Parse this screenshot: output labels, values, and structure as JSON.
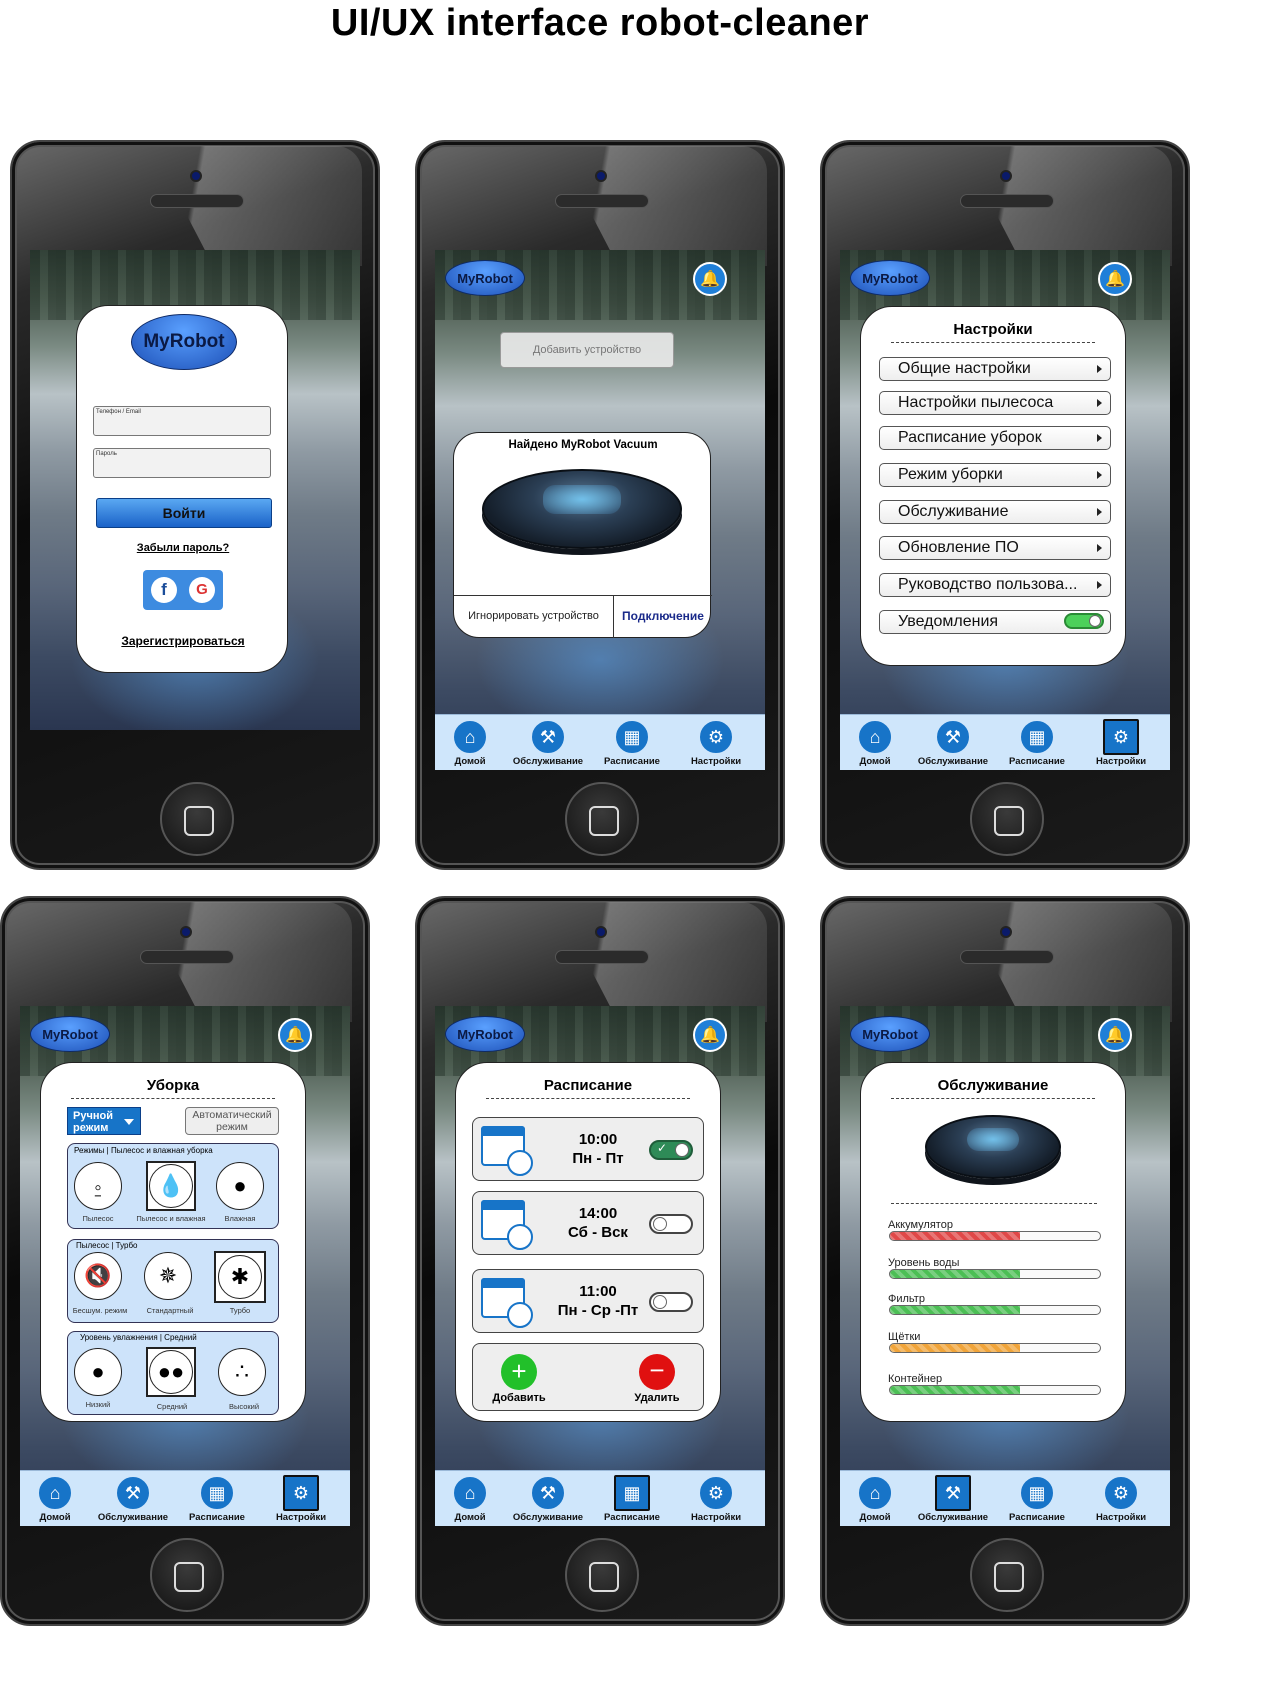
{
  "page_title": "UI/UX  interface robot-cleaner",
  "brand": "MyRobot",
  "nav": {
    "home": "Домой",
    "service": "Обслуживание",
    "schedule": "Расписание",
    "settings": "Настройки"
  },
  "login": {
    "brand": "MyRobot",
    "phone_label": "Телефон / Email",
    "password_label": "Пароль",
    "login_button": "Войти",
    "forgot": "Забыли пароль?",
    "register": "Зарегистрироваться",
    "facebook_letter": "f",
    "google_letter": "G"
  },
  "device": {
    "add_device_placeholder": "Добавить устройство",
    "found_title": "Найдено MyRobot Vacuum",
    "ignore": "Игнорировать устройство",
    "connect": "Подключение"
  },
  "settings": {
    "title": "Настройки",
    "items": [
      "Общие настройки",
      "Настройки пылесоса",
      "Расписание уборок",
      "Режим уборки",
      "Обслуживание",
      "Обновление ПО",
      "Руководство пользова..."
    ],
    "notifications": "Уведомления",
    "notifications_on": true
  },
  "cleaning": {
    "title": "Уборка",
    "manual_mode": "Ручной режим",
    "auto_mode": "Автоматический режим",
    "group1_title": "Режимы | Пылесос и влажная уборка",
    "group1_items": [
      "Пылесос",
      "Пылесос и влажная",
      "Влажная"
    ],
    "group2_title": "Пылесос | Турбо",
    "group2_items": [
      "Бесшум. режим",
      "Стандартный",
      "Турбо"
    ],
    "group3_title": "Уровень увлажнения | Средний",
    "group3_items": [
      "Низкий",
      "Средний",
      "Высокий"
    ]
  },
  "schedule": {
    "title": "Расписание",
    "entries": [
      {
        "time": "10:00",
        "days": "Пн - Пт",
        "on": true
      },
      {
        "time": "14:00",
        "days": "Сб - Вск",
        "on": false
      },
      {
        "time": "11:00",
        "days": "Пн - Ср -Пт",
        "on": false
      }
    ],
    "add": "Добавить",
    "delete": "Удалить",
    "add_color": "#22c02a",
    "delete_color": "#e01010"
  },
  "maintenance": {
    "title": "Обслуживание",
    "bars": [
      {
        "label": "Аккумулятор",
        "level": 0.62,
        "color": "#e04848"
      },
      {
        "label": "Уровень воды",
        "level": 0.62,
        "color": "#4cbf55"
      },
      {
        "label": "Фильтр",
        "level": 0.62,
        "color": "#4cbf55"
      },
      {
        "label": "Щётки",
        "level": 0.62,
        "color": "#f0a43a"
      },
      {
        "label": "Контейнер",
        "level": 0.62,
        "color": "#4cbf55"
      }
    ]
  },
  "colors": {
    "accent": "#1774c8",
    "navbar": "#cfe6fb",
    "group_bg": "#cde3fa"
  }
}
